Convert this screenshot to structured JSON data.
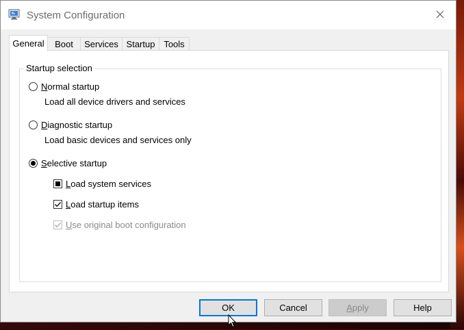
{
  "window": {
    "title": "System Configuration"
  },
  "tabs": [
    {
      "label": "General",
      "active": true
    },
    {
      "label": "Boot",
      "active": false
    },
    {
      "label": "Services",
      "active": false
    },
    {
      "label": "Startup",
      "active": false
    },
    {
      "label": "Tools",
      "active": false
    }
  ],
  "startup_selection": {
    "group_label": "Startup selection",
    "normal": {
      "first": "N",
      "rest": "ormal startup",
      "description": "Load all device drivers and services",
      "checked": false
    },
    "diagnostic": {
      "first": "D",
      "rest": "iagnostic startup",
      "description": "Load basic devices and services only",
      "checked": false
    },
    "selective": {
      "first": "S",
      "rest": "elective startup",
      "checked": true
    },
    "options": [
      {
        "first": "L",
        "rest": "oad system services",
        "state": "indeterminate",
        "enabled": true
      },
      {
        "first": "L",
        "rest": "oad startup items",
        "state": "checked",
        "enabled": true
      },
      {
        "first": "U",
        "rest": "se original boot configuration",
        "state": "checked",
        "enabled": false
      }
    ]
  },
  "buttons": {
    "ok": "OK",
    "cancel": "Cancel",
    "apply_first": "A",
    "apply_rest": "pply",
    "help": "Help"
  }
}
